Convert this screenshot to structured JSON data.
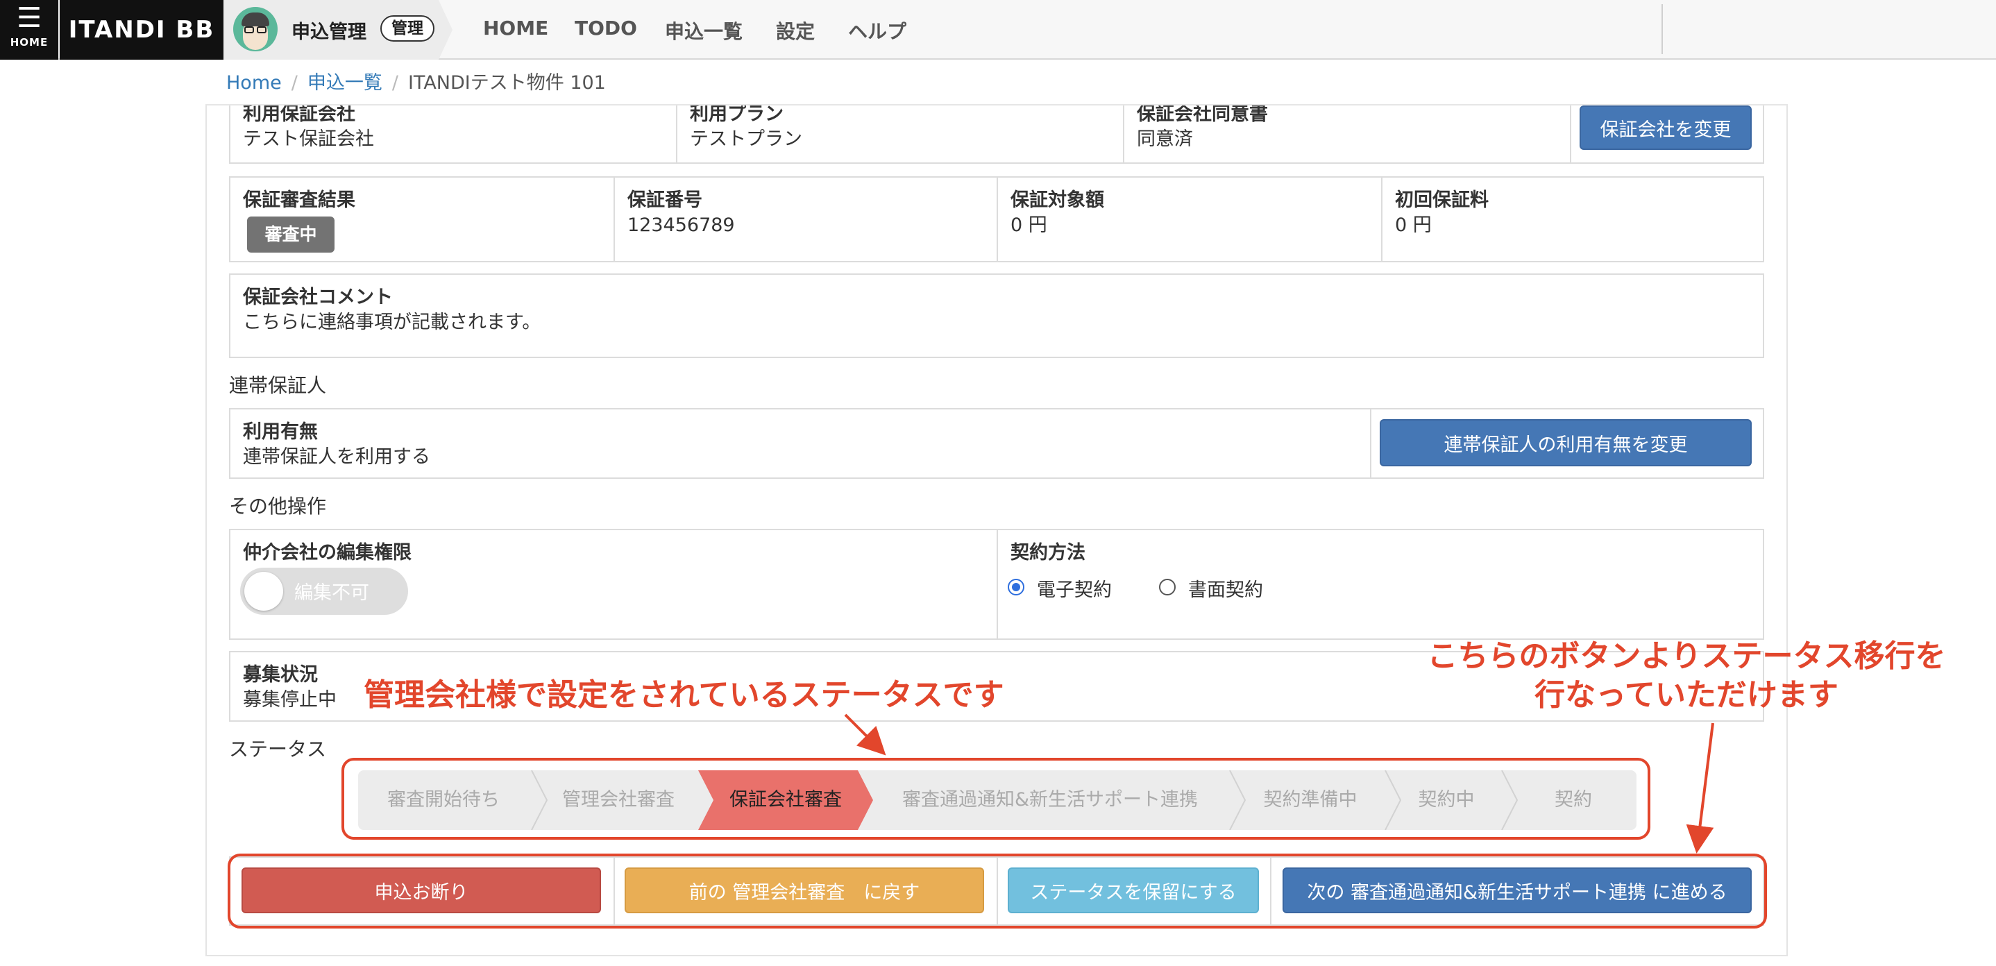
{
  "navbar": {
    "menu_label": "HOME",
    "brand": "ITANDI BB",
    "app_name": "申込管理",
    "app_badge": "管理",
    "items": [
      "HOME",
      "TODO",
      "申込一覧",
      "設定",
      "ヘルプ"
    ]
  },
  "breadcrumb": {
    "home": "Home",
    "list": "申込一覧",
    "current": "ITANDIテスト物件 101"
  },
  "guarantor_company": {
    "company_label": "利用保証会社",
    "company_value": "テスト保証会社",
    "plan_label": "利用プラン",
    "plan_value": "テストプラン",
    "consent_label": "保証会社同意書",
    "consent_value": "同意済",
    "change_button": "保証会社を変更"
  },
  "guarantee": {
    "result_label": "保証審査結果",
    "result_badge": "審査中",
    "number_label": "保証番号",
    "number_value": "123456789",
    "amount_label": "保証対象額",
    "amount_value": "0 円",
    "fee_label": "初回保証料",
    "fee_value": "0 円"
  },
  "comment": {
    "label": "保証会社コメント",
    "value": "こちらに連絡事項が記載されます。"
  },
  "joint_guarantor": {
    "section_title": "連帯保証人",
    "usage_label": "利用有無",
    "usage_value": "連帯保証人を利用する",
    "change_button": "連帯保証人の利用有無を変更"
  },
  "other": {
    "section_title": "その他操作",
    "edit_label": "仲介会社の編集権限",
    "edit_toggle": "編集不可",
    "contract_label": "契約方法",
    "contract_options": [
      "電子契約",
      "書面契約"
    ],
    "contract_selected": "電子契約"
  },
  "recruit": {
    "label": "募集状況",
    "value": "募集停止中"
  },
  "status": {
    "section_title": "ステータス",
    "steps": [
      "審査開始待ち",
      "管理会社審査",
      "保証会社審査",
      "審査通過通知&新生活サポート連携",
      "契約準備中",
      "契約中",
      "契約"
    ],
    "active_step": "保証会社審査"
  },
  "actions": {
    "decline": "申込お断り",
    "back": "前の 管理会社審査　に戻す",
    "hold": "ステータスを保留にする",
    "next": "次の 審査通過通知&新生活サポート連携 に進める"
  },
  "annotations": {
    "status_note": "管理会社様で設定をされているステータスです",
    "button_note_line1": "こちらのボタンよりステータス移行を",
    "button_note_line2": "行なっていただけます"
  },
  "colors": {
    "primary": "#4577b5",
    "danger": "#d15b52",
    "warning": "#e9ae55",
    "info": "#72c0de",
    "active_step": "#e9716b",
    "annotation": "#e2462c"
  }
}
